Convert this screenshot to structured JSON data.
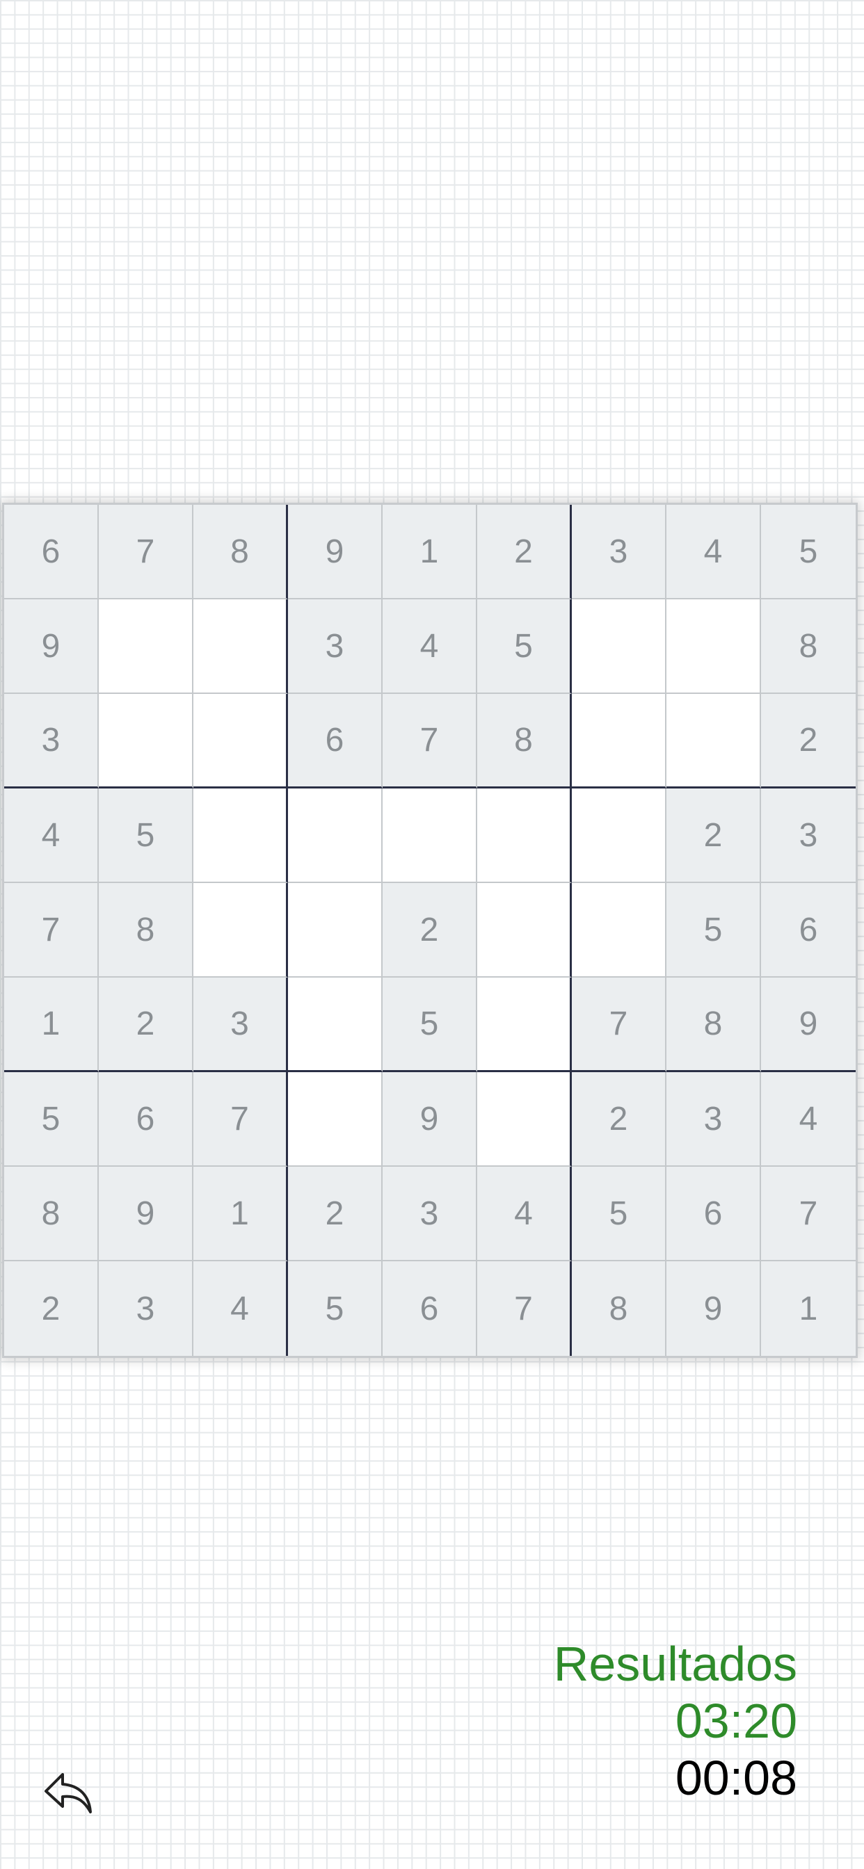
{
  "board": {
    "cells": [
      [
        "6",
        "7",
        "8",
        "9",
        "1",
        "2",
        "3",
        "4",
        "5"
      ],
      [
        "9",
        "",
        "",
        "3",
        "4",
        "5",
        "",
        "",
        "8"
      ],
      [
        "3",
        "",
        "",
        "6",
        "7",
        "8",
        "",
        "",
        "2"
      ],
      [
        "4",
        "5",
        "",
        "",
        "",
        "",
        "",
        "2",
        "3"
      ],
      [
        "7",
        "8",
        "",
        "",
        "2",
        "",
        "",
        "5",
        "6"
      ],
      [
        "1",
        "2",
        "3",
        "",
        "5",
        "",
        "7",
        "8",
        "9"
      ],
      [
        "5",
        "6",
        "7",
        "",
        "9",
        "",
        "2",
        "3",
        "4"
      ],
      [
        "8",
        "9",
        "1",
        "2",
        "3",
        "4",
        "5",
        "6",
        "7"
      ],
      [
        "2",
        "3",
        "4",
        "5",
        "6",
        "7",
        "8",
        "9",
        "1"
      ]
    ]
  },
  "results": {
    "label": "Resultados",
    "best_time": "03:20",
    "current_time": "00:08"
  },
  "controls": {
    "undo_icon": "undo-icon"
  },
  "colors": {
    "given_bg": "#ebeef0",
    "empty_bg": "#ffffff",
    "digit": "#8a8f93",
    "accent_green": "#2e8b2a"
  }
}
